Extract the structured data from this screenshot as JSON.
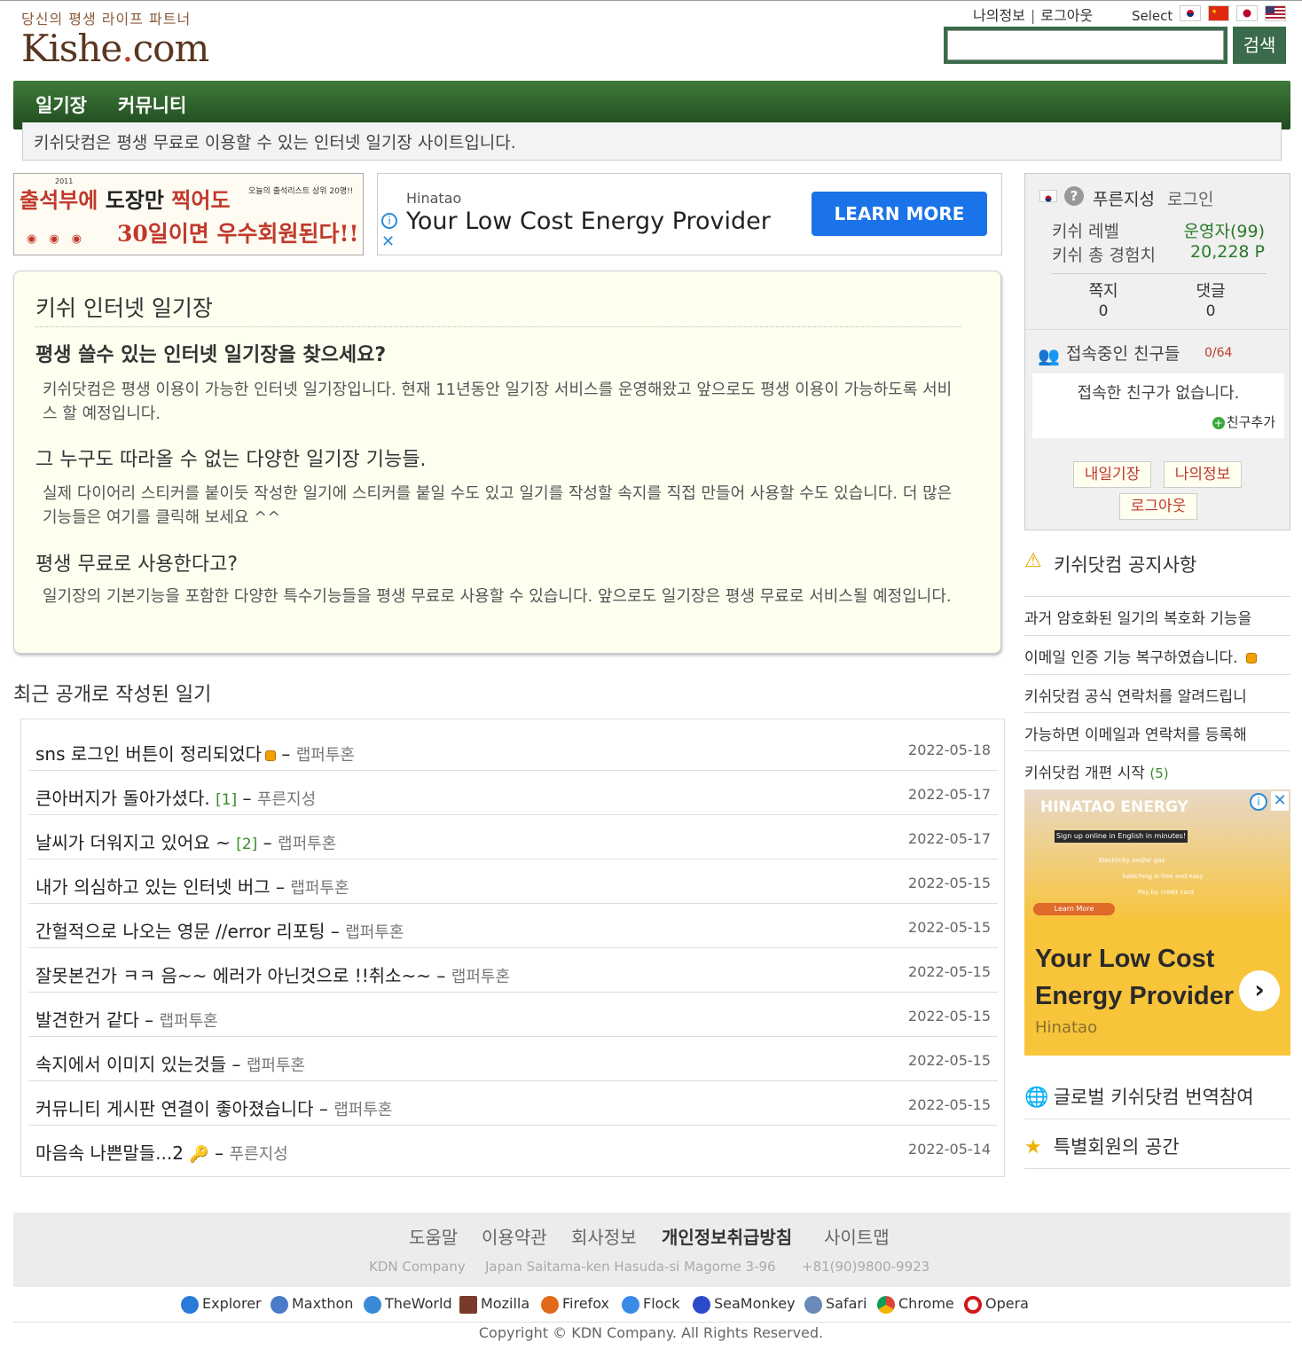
{
  "header": {
    "logo_tagline": "당신의 평생 라이프 파트너",
    "logo_text": "Kishe",
    "logo_dot": ".",
    "logo_suffix": "com",
    "link_myinfo": "나의정보",
    "link_logout": "로그아웃",
    "select_label": "Select",
    "search_button": "검색",
    "search_value": ""
  },
  "nav": {
    "items": [
      {
        "label": "일기장"
      },
      {
        "label": "커뮤니티"
      }
    ],
    "notice": "키쉬닷컴은 평생 무료로 이용할 수 있는 인터넷 일기장 사이트입니다."
  },
  "banner1": {
    "line1_red": "출석부에",
    "line1_black": "도장만",
    "line1_red2": "찍어도",
    "line2": "30일이면 우수회원된다!!",
    "small": "오늘의 출석리스트 상위 20명!!",
    "year": "2011"
  },
  "ad_top": {
    "advertiser": "Hinatao",
    "headline": "Your Low Cost Energy Provider",
    "cta": "LEARN MORE"
  },
  "intro": {
    "title": "키쉬 인터넷 일기장",
    "h1": "평생 쓸수 있는 인터넷 일기장을 찾으세요?",
    "p1": "키쉬닷컴은 평생 이용이 가능한 인터넷 일기장입니다. 현재 11년동안 일기장 서비스를 운영해왔고 앞으로도 평생 이용이 가능하도록 서비스 할 예정입니다.",
    "h2": "그 누구도 따라올 수 없는 다양한 일기장 기능들.",
    "p2": "실제 다이어리 스티커를 붙이듯 작성한 일기에 스티커를 붙일 수도 있고 일기를 작성할 속지를 직접 만들어 사용할 수도 있습니다. 더 많은 기능들은 여기를 클릭해 보세요 ^^",
    "h3": "평생 무료로 사용한다고?",
    "p3": "일기장의 기본기능을 포함한 다양한 특수기능들을 평생 무료로 사용할 수 있습니다. 앞으로도 일기장은 평생 무료로 서비스될 예정입니다."
  },
  "recent": {
    "title": "최근 공개로 작성된 일기",
    "rows": [
      {
        "title": "sns 로그인 버튼이 정리되었다",
        "count": "",
        "author": "랩퍼투혼",
        "date": "2022-05-18",
        "badge": "new"
      },
      {
        "title": "큰아버지가 돌아가셨다.",
        "count": "[1]",
        "author": "푸른지성",
        "date": "2022-05-17",
        "badge": ""
      },
      {
        "title": "날씨가 더워지고 있어요 ~",
        "count": "[2]",
        "author": "랩퍼투혼",
        "date": "2022-05-17",
        "badge": ""
      },
      {
        "title": "내가 의심하고 있는 인터넷 버그",
        "count": "",
        "author": "랩퍼투혼",
        "date": "2022-05-15",
        "badge": ""
      },
      {
        "title": "간헐적으로 나오는 영문 //error 리포팅",
        "count": "",
        "author": "랩퍼투혼",
        "date": "2022-05-15",
        "badge": ""
      },
      {
        "title": "잘못본건가 ㅋㅋ 음~~ 에러가 아닌것으로 !!취소~~",
        "count": "",
        "author": "랩퍼투혼",
        "date": "2022-05-15",
        "badge": ""
      },
      {
        "title": "발견한거 같다",
        "count": "",
        "author": "랩퍼투혼",
        "date": "2022-05-15",
        "badge": ""
      },
      {
        "title": "속지에서 이미지 있는것들",
        "count": "",
        "author": "랩퍼투혼",
        "date": "2022-05-15",
        "badge": ""
      },
      {
        "title": "커뮤니티 게시판 연결이 좋아졌습니다",
        "count": "",
        "author": "랩퍼투혼",
        "date": "2022-05-15",
        "badge": ""
      },
      {
        "title": "마음속 나쁜말들...2",
        "count": "",
        "author": "푸른지성",
        "date": "2022-05-14",
        "badge": "key"
      }
    ]
  },
  "userbox": {
    "name": "푸른지성",
    "login": "로그인",
    "level_label": "키쉬 레벨",
    "level_value": "운영자(99)",
    "exp_label": "키쉬 총 경험치",
    "exp_value": "20,228 P",
    "memo_label": "쪽지",
    "memo_value": "0",
    "comment_label": "댓글",
    "comment_value": "0",
    "friends_title": "접속중인 친구들",
    "friends_count": "0/64",
    "friends_empty": "접속한 친구가 없습니다.",
    "friend_add": "친구추가",
    "btn_diary": "내일기장",
    "btn_myinfo": "나의정보",
    "btn_logout": "로그아웃"
  },
  "notices": {
    "title": "키쉬닷컴 공지사항",
    "items": [
      {
        "text": "과거 암호화된 일기의 복호화 기능을",
        "count": ""
      },
      {
        "text": "이메일 인증 기능 복구하였습니다.",
        "count": ""
      },
      {
        "text": "키쉬닷컴 공식 연락처를 알려드립니",
        "count": ""
      },
      {
        "text": "가능하면 이메일과 연락처를 등록해",
        "count": ""
      },
      {
        "text": "키쉬닷컴 개편 시작",
        "count": "(5)"
      }
    ]
  },
  "ad_side": {
    "brand": "HINATAO ENERGY",
    "signup": "Sign up online in English in minutes!",
    "f1": "Electricity and/or gas",
    "f2": "Switching is free and easy",
    "f3": "Pay by credit card",
    "learn": "Learn More",
    "headline": "Your Low Cost Energy Provider",
    "advertiser": "Hinatao"
  },
  "side_links": [
    {
      "label": "글로벌 키쉬닷컴 번역참여",
      "icon": "globe-icon"
    },
    {
      "label": "특별회원의 공간",
      "icon": "star-icon"
    }
  ],
  "footer": {
    "links": [
      "도움말",
      "이용약관",
      "회사정보",
      "개인정보취급방침",
      "사이트맵"
    ],
    "company": "KDN Company",
    "address": "Japan Saitama-ken Hasuda-si Magome 3-96",
    "phone": "+81(90)9800-9923",
    "browsers": [
      "Explorer",
      "Maxthon",
      "TheWorld",
      "Mozilla",
      "Firefox",
      "Flock",
      "SeaMonkey",
      "Safari",
      "Chrome",
      "Opera"
    ],
    "copyright": "Copyright © KDN Company. All Rights Reserved."
  }
}
